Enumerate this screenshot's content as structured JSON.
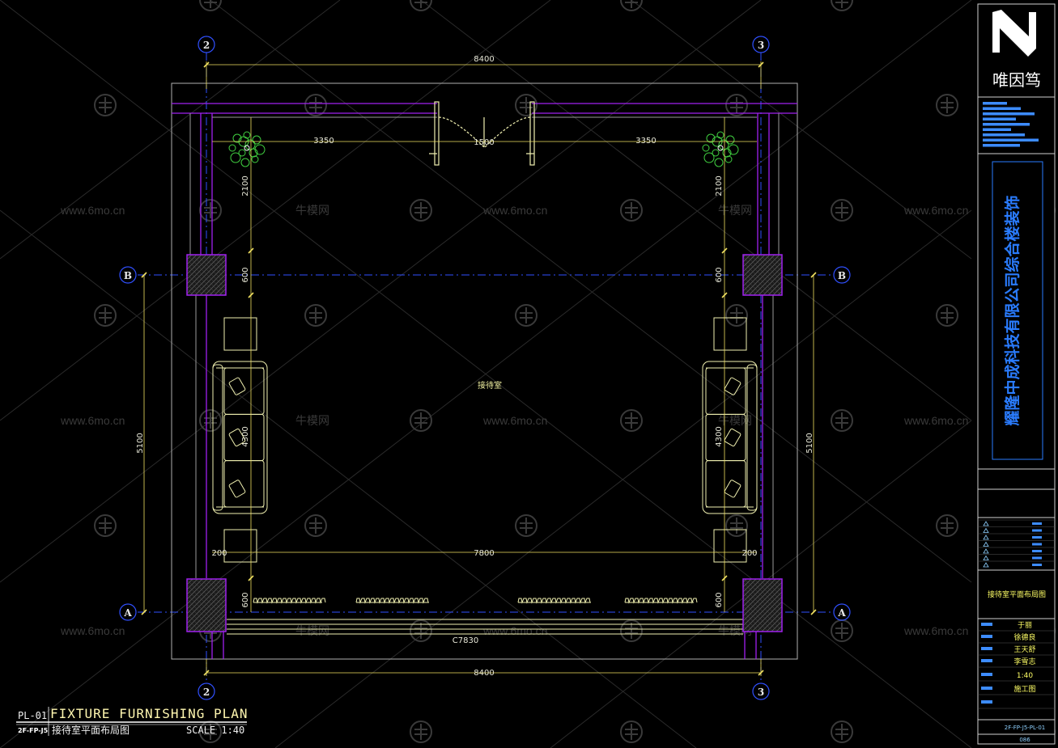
{
  "drawing": {
    "plan_code": "PL-01",
    "plan_title": "FIXTURE FURNISHING PLAN",
    "plan_ref": "2F-FP-J5",
    "plan_subtitle": "接待室平面布局图",
    "scale": "SCALE 1:40",
    "room_name": "接待室"
  },
  "dimensions": {
    "top_total": "8400",
    "bottom_total": "8400",
    "left_seg": "3350",
    "right_seg": "3350",
    "door_width": "1500",
    "left_height": "5100",
    "right_height": "5100",
    "upper_left": "2100",
    "upper_right": "2100",
    "col_left": "600",
    "col_right": "600",
    "sofa_left": "4300",
    "sofa_right": "4300",
    "inner_width": "7800",
    "gap_left": "200",
    "gap_right": "200",
    "lower_left": "600",
    "lower_right": "600",
    "window_width": "C7830"
  },
  "axes": {
    "top_left": "2",
    "top_right": "3",
    "bottom_left": "2",
    "bottom_right": "3",
    "mid_left": "B",
    "mid_right": "B",
    "low_left": "A",
    "low_right": "A"
  },
  "watermark": {
    "site": "www.6mo.cn",
    "brand": "牛模网"
  },
  "title_block": {
    "logo_text": "唯因笃",
    "company": "耀隆中成科技有限公司综合楼装饰",
    "sheet_name": "接待室平面布局图",
    "names": [
      "于丽",
      "徐德良",
      "王天舒",
      "李雪志"
    ],
    "scale": "1:40",
    "stage": "施工图",
    "sheet_no": "2F-FP-J5-PL-01",
    "page": "086"
  },
  "colors": {
    "background": "#000000",
    "wall": "#a020f0",
    "dim": "#f0e060",
    "axis_line": "#3050ff",
    "furniture": "#f0f0b0",
    "plant": "#40d040"
  }
}
